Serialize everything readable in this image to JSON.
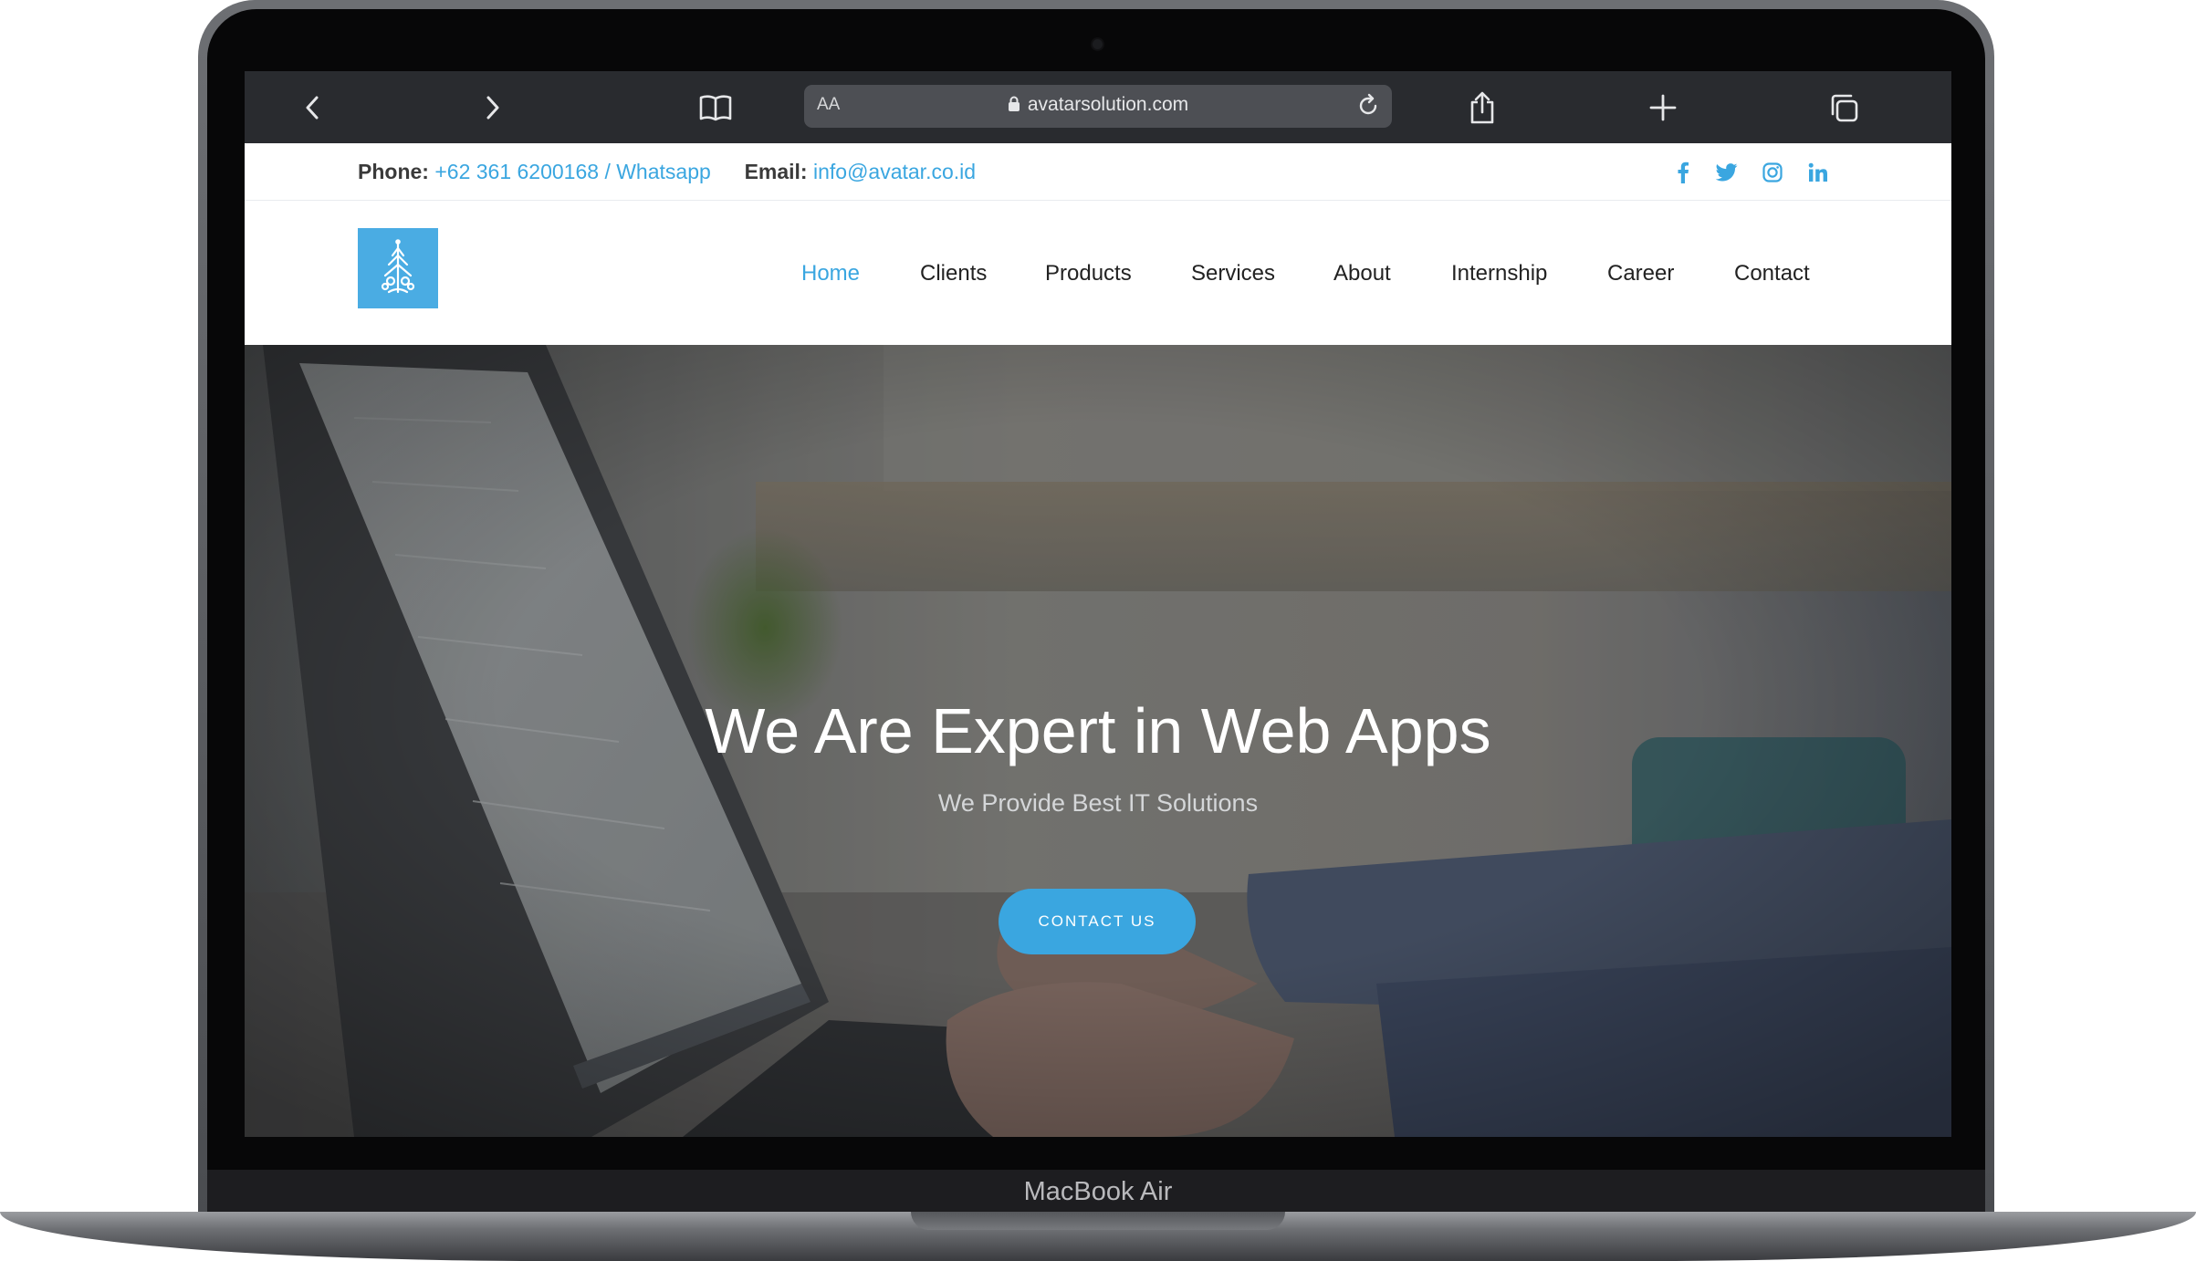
{
  "browser": {
    "url": "avatarsolution.com",
    "reader_label": "AA",
    "icons": [
      "chevron-left-icon",
      "chevron-right-icon",
      "book-icon",
      "lock-icon",
      "reload-icon",
      "share-icon",
      "plus-icon",
      "tabs-icon"
    ]
  },
  "topbar": {
    "phone_label": "Phone:",
    "phone_value": "+62 361 6200168 / Whatsapp",
    "email_label": "Email:",
    "email_value": "info@avatar.co.id",
    "social_icons": [
      "facebook-icon",
      "twitter-icon",
      "instagram-icon",
      "linkedin-icon"
    ]
  },
  "nav": {
    "items": [
      "Home",
      "Clients",
      "Products",
      "Services",
      "About",
      "Internship",
      "Career",
      "Contact"
    ],
    "active": "Home"
  },
  "hero": {
    "title": "We Are Expert in Web Apps",
    "subtitle": "We Provide Best IT Solutions",
    "button": "CONTACT US"
  },
  "device": {
    "label": "MacBook Air"
  },
  "colors": {
    "accent": "#3aa6e0",
    "toolbar": "#292b2f",
    "logo_bg": "#4aace3"
  }
}
